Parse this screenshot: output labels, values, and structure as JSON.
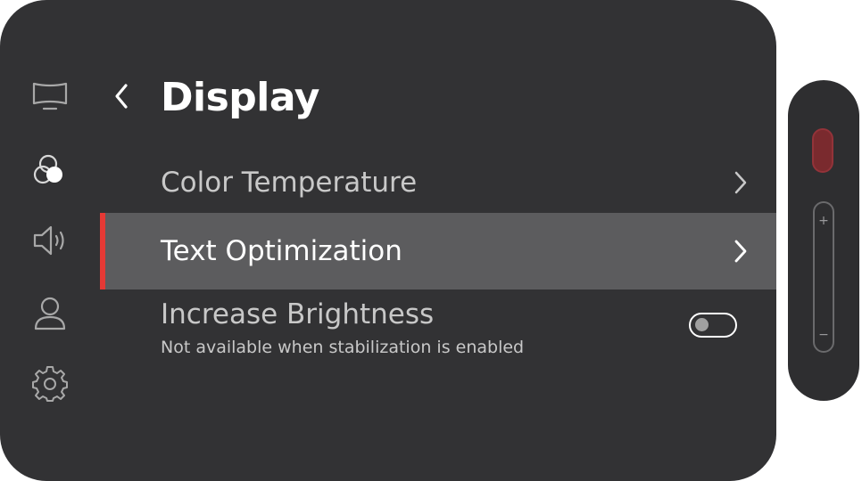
{
  "header": {
    "title": "Display"
  },
  "sidebar": {
    "items": [
      {
        "icon": "monitor-icon"
      },
      {
        "icon": "color-circles-icon"
      },
      {
        "icon": "speaker-icon"
      },
      {
        "icon": "user-icon"
      },
      {
        "icon": "gear-icon"
      }
    ]
  },
  "menu": {
    "color_temperature": "Color Temperature",
    "text_optimization": "Text Optimization",
    "increase_brightness": "Increase Brightness",
    "increase_brightness_note": "Not available when stabilization is enabled",
    "increase_brightness_enabled": false
  },
  "side_control": {
    "plus": "+",
    "minus": "−"
  },
  "colors": {
    "panel": "#323234",
    "selected_row": "#5c5c5e",
    "accent": "#e53935",
    "record": "#7a2a2e"
  }
}
